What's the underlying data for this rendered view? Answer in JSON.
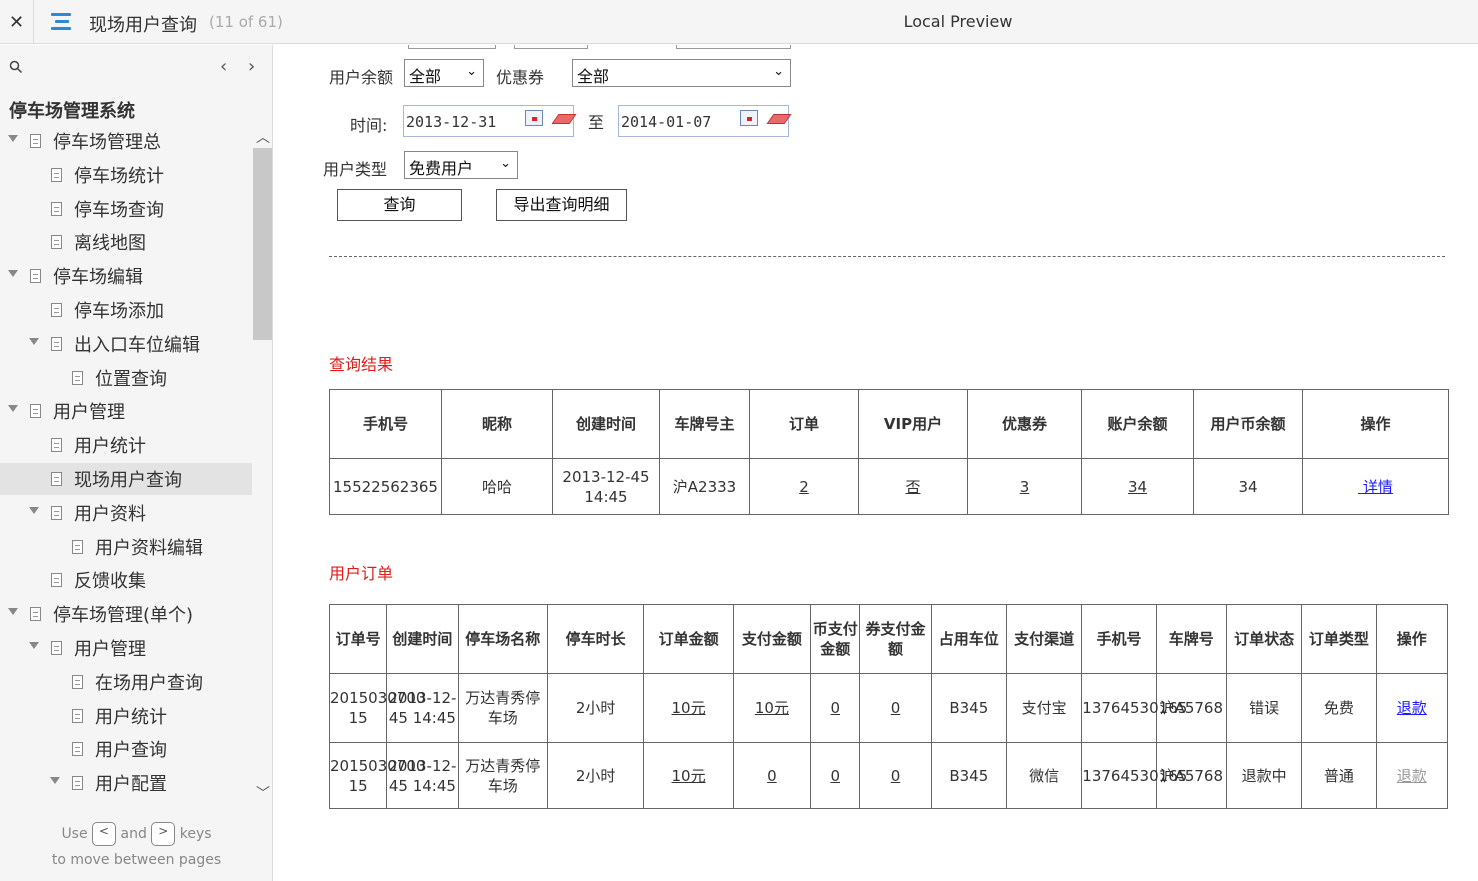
{
  "topbar": {
    "page_title": "现场用户查询",
    "page_count": "(11 of 61)",
    "preview_title": "Local Preview"
  },
  "sidebar": {
    "app_name": "停车场管理系统",
    "items": [
      {
        "label": "停车场管理总",
        "level": 0,
        "caret": true
      },
      {
        "label": "停车场统计",
        "level": 1,
        "caret": false
      },
      {
        "label": "停车场查询",
        "level": 1,
        "caret": false
      },
      {
        "label": "离线地图",
        "level": 1,
        "caret": false
      },
      {
        "label": "停车场编辑",
        "level": 0,
        "caret": true
      },
      {
        "label": "停车场添加",
        "level": 1,
        "caret": false
      },
      {
        "label": "出入口车位编辑",
        "level": 1,
        "caret": true
      },
      {
        "label": "位置查询",
        "level": 2,
        "caret": false
      },
      {
        "label": "用户管理",
        "level": 0,
        "caret": true
      },
      {
        "label": "用户统计",
        "level": 1,
        "caret": false
      },
      {
        "label": "现场用户查询",
        "level": 1,
        "caret": false,
        "selected": true
      },
      {
        "label": "用户资料",
        "level": 1,
        "caret": true
      },
      {
        "label": "用户资料编辑",
        "level": 2,
        "caret": false
      },
      {
        "label": "反馈收集",
        "level": 1,
        "caret": false
      },
      {
        "label": "停车场管理(单个)",
        "level": 0,
        "caret": true
      },
      {
        "label": "用户管理",
        "level": 1,
        "caret": true
      },
      {
        "label": "在场用户查询",
        "level": 2,
        "caret": false
      },
      {
        "label": "用户统计",
        "level": 2,
        "caret": false
      },
      {
        "label": "用户查询",
        "level": 2,
        "caret": false
      },
      {
        "label": "用户配置",
        "level": 2,
        "caret": true
      }
    ],
    "hint": {
      "use": "Use",
      "and": "and",
      "keys": "keys",
      "line2": "to move between pages",
      "key_prev": "<",
      "key_next": ">"
    }
  },
  "form": {
    "balance_label": "用户余额",
    "balance_value": "全部",
    "coupon_label": "优惠券",
    "coupon_value": "全部",
    "time_label": "时间:",
    "date_from": "2013-12-31",
    "to_label": "至",
    "date_to": "2014-01-07",
    "user_type_label": "用户类型",
    "user_type_value": "免费用户",
    "query_button": "查询",
    "export_button": "导出查询明细"
  },
  "result": {
    "title": "查询结果",
    "headers": [
      "手机号",
      "昵称",
      "创建时间",
      "车牌号主",
      "订单",
      "VIP用户",
      "优惠券",
      "账户余额",
      "用户币余额",
      "操作"
    ],
    "row": {
      "phone": "15522562365",
      "nickname": "哈哈",
      "created_date": "2013-12-45",
      "created_time": "14:45",
      "plate": "沪A2333",
      "orders": "2",
      "vip": "否",
      "coupons": "3",
      "balance": "34",
      "coin_balance": "34",
      "action": " 详情"
    }
  },
  "orders": {
    "title": "用户订单",
    "headers": [
      "订单号",
      "创建时间",
      "停车场名称",
      "停车时长",
      "订单金额",
      "支付金额",
      "币支付金额",
      "券支付金额",
      "占用车位",
      "支付渠道",
      "手机号",
      "车牌号",
      "订单状态",
      "订单类型",
      "操作"
    ],
    "rows": [
      {
        "order_no": "2015030700 15",
        "created": "2013-12-45 14:45",
        "parking": "万达青秀停车场",
        "duration": "2小时",
        "amount": "10元",
        "paid": "10元",
        "coin_paid": "0",
        "coupon_paid": "0",
        "spot": "B345",
        "channel": "支付宝",
        "phone": "13764530165",
        "plate": "沪A5768",
        "status": "错误",
        "type": "免费",
        "action": "退款",
        "action_enabled": true
      },
      {
        "order_no": "2015030700 15",
        "created": "2013-12-45 14:45",
        "parking": "万达青秀停车场",
        "duration": "2小时",
        "amount": "10元",
        "paid": "0",
        "coin_paid": "0",
        "coupon_paid": "0",
        "spot": "B345",
        "channel": "微信",
        "phone": "13764530165",
        "plate": "沪A5768",
        "status": "退款中",
        "type": "普通",
        "action": "退款",
        "action_enabled": false
      }
    ]
  }
}
